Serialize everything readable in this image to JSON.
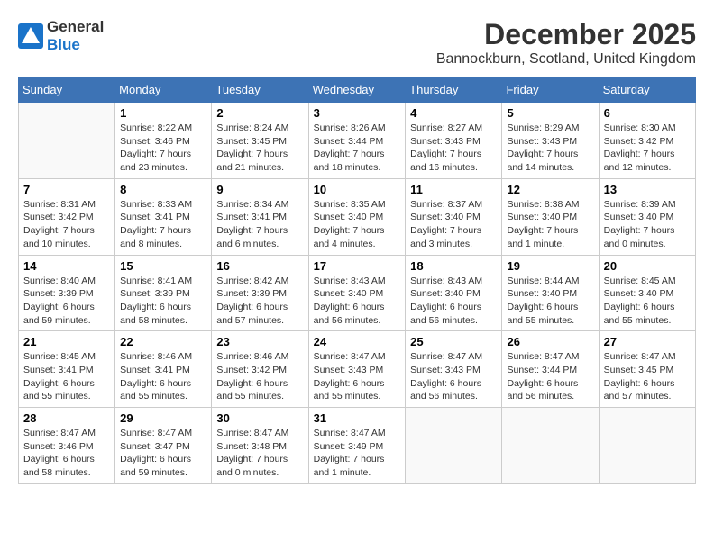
{
  "logo": {
    "general": "General",
    "blue": "Blue"
  },
  "title": "December 2025",
  "location": "Bannockburn, Scotland, United Kingdom",
  "days_of_week": [
    "Sunday",
    "Monday",
    "Tuesday",
    "Wednesday",
    "Thursday",
    "Friday",
    "Saturday"
  ],
  "weeks": [
    [
      {
        "day": "",
        "info": ""
      },
      {
        "day": "1",
        "info": "Sunrise: 8:22 AM\nSunset: 3:46 PM\nDaylight: 7 hours\nand 23 minutes."
      },
      {
        "day": "2",
        "info": "Sunrise: 8:24 AM\nSunset: 3:45 PM\nDaylight: 7 hours\nand 21 minutes."
      },
      {
        "day": "3",
        "info": "Sunrise: 8:26 AM\nSunset: 3:44 PM\nDaylight: 7 hours\nand 18 minutes."
      },
      {
        "day": "4",
        "info": "Sunrise: 8:27 AM\nSunset: 3:43 PM\nDaylight: 7 hours\nand 16 minutes."
      },
      {
        "day": "5",
        "info": "Sunrise: 8:29 AM\nSunset: 3:43 PM\nDaylight: 7 hours\nand 14 minutes."
      },
      {
        "day": "6",
        "info": "Sunrise: 8:30 AM\nSunset: 3:42 PM\nDaylight: 7 hours\nand 12 minutes."
      }
    ],
    [
      {
        "day": "7",
        "info": "Sunrise: 8:31 AM\nSunset: 3:42 PM\nDaylight: 7 hours\nand 10 minutes."
      },
      {
        "day": "8",
        "info": "Sunrise: 8:33 AM\nSunset: 3:41 PM\nDaylight: 7 hours\nand 8 minutes."
      },
      {
        "day": "9",
        "info": "Sunrise: 8:34 AM\nSunset: 3:41 PM\nDaylight: 7 hours\nand 6 minutes."
      },
      {
        "day": "10",
        "info": "Sunrise: 8:35 AM\nSunset: 3:40 PM\nDaylight: 7 hours\nand 4 minutes."
      },
      {
        "day": "11",
        "info": "Sunrise: 8:37 AM\nSunset: 3:40 PM\nDaylight: 7 hours\nand 3 minutes."
      },
      {
        "day": "12",
        "info": "Sunrise: 8:38 AM\nSunset: 3:40 PM\nDaylight: 7 hours\nand 1 minute."
      },
      {
        "day": "13",
        "info": "Sunrise: 8:39 AM\nSunset: 3:40 PM\nDaylight: 7 hours\nand 0 minutes."
      }
    ],
    [
      {
        "day": "14",
        "info": "Sunrise: 8:40 AM\nSunset: 3:39 PM\nDaylight: 6 hours\nand 59 minutes."
      },
      {
        "day": "15",
        "info": "Sunrise: 8:41 AM\nSunset: 3:39 PM\nDaylight: 6 hours\nand 58 minutes."
      },
      {
        "day": "16",
        "info": "Sunrise: 8:42 AM\nSunset: 3:39 PM\nDaylight: 6 hours\nand 57 minutes."
      },
      {
        "day": "17",
        "info": "Sunrise: 8:43 AM\nSunset: 3:40 PM\nDaylight: 6 hours\nand 56 minutes."
      },
      {
        "day": "18",
        "info": "Sunrise: 8:43 AM\nSunset: 3:40 PM\nDaylight: 6 hours\nand 56 minutes."
      },
      {
        "day": "19",
        "info": "Sunrise: 8:44 AM\nSunset: 3:40 PM\nDaylight: 6 hours\nand 55 minutes."
      },
      {
        "day": "20",
        "info": "Sunrise: 8:45 AM\nSunset: 3:40 PM\nDaylight: 6 hours\nand 55 minutes."
      }
    ],
    [
      {
        "day": "21",
        "info": "Sunrise: 8:45 AM\nSunset: 3:41 PM\nDaylight: 6 hours\nand 55 minutes."
      },
      {
        "day": "22",
        "info": "Sunrise: 8:46 AM\nSunset: 3:41 PM\nDaylight: 6 hours\nand 55 minutes."
      },
      {
        "day": "23",
        "info": "Sunrise: 8:46 AM\nSunset: 3:42 PM\nDaylight: 6 hours\nand 55 minutes."
      },
      {
        "day": "24",
        "info": "Sunrise: 8:47 AM\nSunset: 3:43 PM\nDaylight: 6 hours\nand 55 minutes."
      },
      {
        "day": "25",
        "info": "Sunrise: 8:47 AM\nSunset: 3:43 PM\nDaylight: 6 hours\nand 56 minutes."
      },
      {
        "day": "26",
        "info": "Sunrise: 8:47 AM\nSunset: 3:44 PM\nDaylight: 6 hours\nand 56 minutes."
      },
      {
        "day": "27",
        "info": "Sunrise: 8:47 AM\nSunset: 3:45 PM\nDaylight: 6 hours\nand 57 minutes."
      }
    ],
    [
      {
        "day": "28",
        "info": "Sunrise: 8:47 AM\nSunset: 3:46 PM\nDaylight: 6 hours\nand 58 minutes."
      },
      {
        "day": "29",
        "info": "Sunrise: 8:47 AM\nSunset: 3:47 PM\nDaylight: 6 hours\nand 59 minutes."
      },
      {
        "day": "30",
        "info": "Sunrise: 8:47 AM\nSunset: 3:48 PM\nDaylight: 7 hours\nand 0 minutes."
      },
      {
        "day": "31",
        "info": "Sunrise: 8:47 AM\nSunset: 3:49 PM\nDaylight: 7 hours\nand 1 minute."
      },
      {
        "day": "",
        "info": ""
      },
      {
        "day": "",
        "info": ""
      },
      {
        "day": "",
        "info": ""
      }
    ]
  ]
}
